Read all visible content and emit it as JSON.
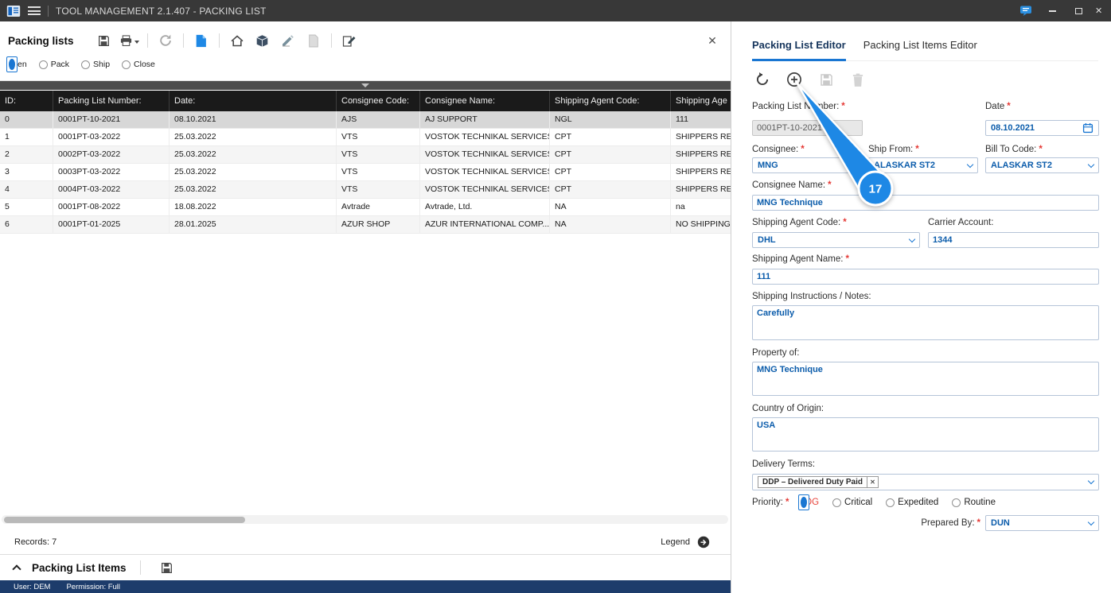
{
  "titlebar": {
    "title": "TOOL MANAGEMENT 2.1.407 - PACKING LIST"
  },
  "left_panel": {
    "title": "Packing lists",
    "filters": [
      {
        "label": "Open",
        "selected": true
      },
      {
        "label": "Pack",
        "selected": false
      },
      {
        "label": "Ship",
        "selected": false
      },
      {
        "label": "Close",
        "selected": false
      }
    ],
    "toolbar_icons": [
      "save-icon",
      "print-icon",
      "refresh-icon",
      "new-document-icon",
      "home-icon",
      "package-icon",
      "signature-icon",
      "copy-document-icon",
      "edit-icon"
    ],
    "table": {
      "columns": [
        "ID:",
        "Packing List Number:",
        "Date:",
        "Consignee Code:",
        "Consignee Name:",
        "Shipping Agent Code:",
        "Shipping Age"
      ],
      "rows": [
        [
          "0",
          "0001PT-10-2021",
          "08.10.2021",
          "AJS",
          "AJ SUPPORT",
          "NGL",
          "111"
        ],
        [
          "1",
          "0001PT-03-2022",
          "25.03.2022",
          "VTS",
          "VOSTOK TECHNIKAL SERVICES",
          "CPT",
          "SHIPPERS RESPO"
        ],
        [
          "2",
          "0002PT-03-2022",
          "25.03.2022",
          "VTS",
          "VOSTOK TECHNIKAL SERVICES",
          "CPT",
          "SHIPPERS RESPO"
        ],
        [
          "3",
          "0003PT-03-2022",
          "25.03.2022",
          "VTS",
          "VOSTOK TECHNIKAL SERVICES",
          "CPT",
          "SHIPPERS RESPO"
        ],
        [
          "4",
          "0004PT-03-2022",
          "25.03.2022",
          "VTS",
          "VOSTOK TECHNIKAL SERVICES",
          "CPT",
          "SHIPPERS RESPO"
        ],
        [
          "5",
          "0001PT-08-2022",
          "18.08.2022",
          "Avtrade",
          "Avtrade, Ltd.",
          "NA",
          "na"
        ],
        [
          "6",
          "0001PT-01-2025",
          "28.01.2025",
          "AZUR SHOP",
          "AZUR INTERNATIONAL COMP...",
          "NA",
          "NO SHIPPING A"
        ]
      ],
      "selected_row_index": 0
    },
    "records_label": "Records: 7",
    "legend_label": "Legend",
    "items_section_title": "Packing List Items"
  },
  "editor": {
    "tabs": [
      {
        "label": "Packing List Editor",
        "active": true
      },
      {
        "label": "Packing List Items Editor",
        "active": false
      }
    ],
    "toolbar_icons": [
      "undo-icon",
      "add-icon",
      "save-icon",
      "delete-icon"
    ],
    "fields": {
      "packing_list_number": {
        "label": "Packing List Number:",
        "value": "0001PT-10-2021",
        "required": true,
        "disabled": true
      },
      "date": {
        "label": "Date",
        "value": "08.10.2021",
        "required": true
      },
      "consignee": {
        "label": "Consignee:",
        "value": "MNG",
        "required": true
      },
      "ship_from": {
        "label": "Ship From:",
        "value": "ALASKAR ST2",
        "required": true
      },
      "bill_to_code": {
        "label": "Bill To Code:",
        "value": "ALASKAR ST2",
        "required": true
      },
      "consignee_name": {
        "label": "Consignee Name:",
        "value": "MNG Technique",
        "required": true
      },
      "shipping_agent_code": {
        "label": "Shipping Agent Code:",
        "value": "DHL",
        "required": true
      },
      "carrier_account": {
        "label": "Carrier Account:",
        "value": "1344",
        "required": false
      },
      "shipping_agent_name": {
        "label": "Shipping Agent Name:",
        "value": "111",
        "required": true
      },
      "shipping_instructions": {
        "label": "Shipping Instructions / Notes:",
        "value": "Carefully",
        "required": false
      },
      "property_of": {
        "label": "Property of:",
        "value": "MNG Technique",
        "required": false
      },
      "country_of_origin": {
        "label": "Country of Origin:",
        "value": "USA",
        "required": false
      },
      "delivery_terms": {
        "label": "Delivery Terms:",
        "chip_value": "DDP – Delivered Duty Paid",
        "required": false
      },
      "priority": {
        "label": "Priority:",
        "required": true,
        "options": [
          {
            "label": "AOG",
            "selected": true
          },
          {
            "label": "Critical",
            "selected": false
          },
          {
            "label": "Expedited",
            "selected": false
          },
          {
            "label": "Routine",
            "selected": false
          }
        ]
      },
      "prepared_by": {
        "label": "Prepared By:",
        "value": "DUN",
        "required": true
      }
    }
  },
  "statusbar": {
    "user": "User: DEM",
    "permission": "Permission: Full"
  },
  "annotation": {
    "step_number": "17"
  },
  "misc": {
    "required_marker": "*",
    "close_glyph": "✕"
  },
  "colors": {
    "accent_blue": "#1976d2",
    "value_blue": "#0b5cab",
    "required_red": "#e53935",
    "aog_red": "#e8453c",
    "titlebar": "#383838",
    "statusbar": "#1d3c6b",
    "table_header": "#1a1a1a"
  }
}
